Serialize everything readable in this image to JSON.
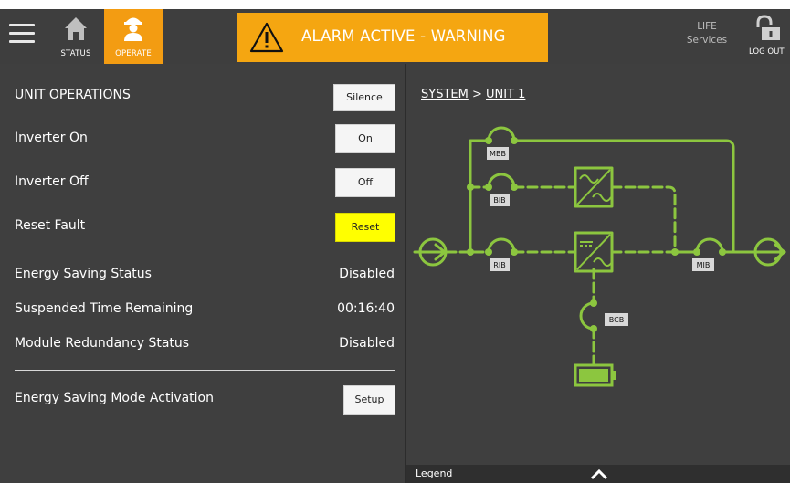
{
  "header": {
    "nav": [
      {
        "label": "STATUS",
        "icon": "home-icon"
      },
      {
        "label": "OPERATE",
        "icon": "operator-icon",
        "active": true
      }
    ],
    "alarm": {
      "text": "ALARM ACTIVE - WARNING",
      "icon": "warning-triangle-icon",
      "color": "#f5a611"
    },
    "life": {
      "line1": "LIFE",
      "line2": "Services"
    },
    "logout": {
      "label": "LOG OUT",
      "icon": "lock-icon"
    }
  },
  "unit_operations": {
    "title": "UNIT OPERATIONS",
    "silence_label": "Silence",
    "actions": [
      {
        "label": "Inverter On",
        "button": "On"
      },
      {
        "label": "Inverter Off",
        "button": "Off"
      },
      {
        "label": "Reset Fault",
        "button": "Reset",
        "color": "#ffff00"
      }
    ],
    "status": [
      {
        "label": "Energy Saving Status",
        "value": "Disabled"
      },
      {
        "label": "Suspended Time Remaining",
        "value": "00:16:40"
      },
      {
        "label": "Module Redundancy Status",
        "value": "Disabled"
      }
    ],
    "energy_mode": {
      "label": "Energy Saving Mode Activation",
      "button": "Setup"
    }
  },
  "system": {
    "breadcrumb": {
      "system": "SYSTEM",
      "separator": " > ",
      "unit": "UNIT 1"
    },
    "diagram": {
      "line_color": "#8cc63f",
      "breakers": [
        "MBB",
        "BIB",
        "RIB",
        "MIB",
        "BCB"
      ]
    },
    "legend_label": "Legend"
  }
}
